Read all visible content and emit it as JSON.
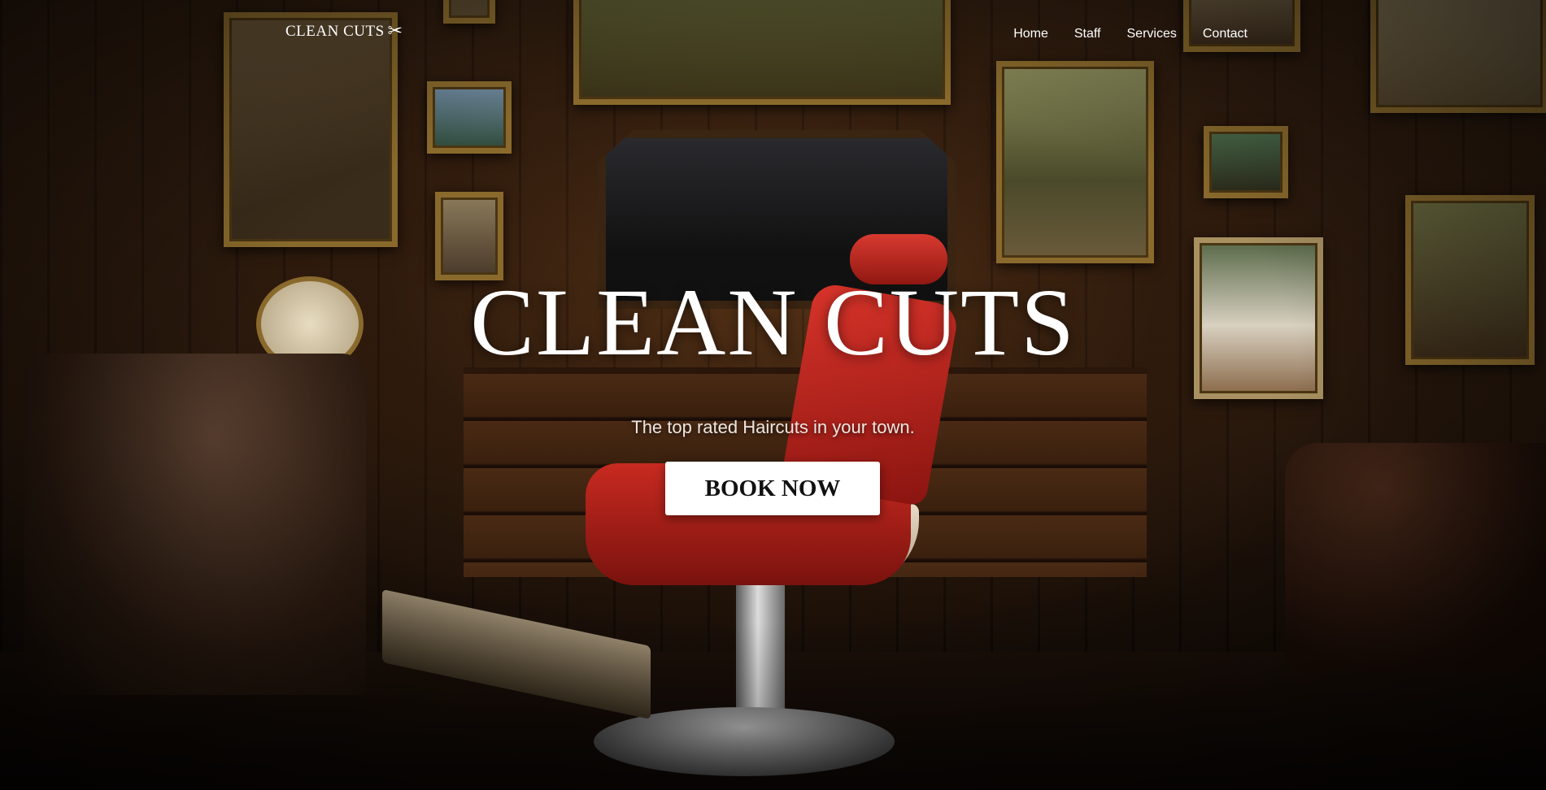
{
  "nav": {
    "logo_text": "CLEAN CUTS",
    "logo_icon": "scissors-icon",
    "links": [
      "Home",
      "Staff",
      "Services",
      "Contact"
    ]
  },
  "hero": {
    "title": "CLEAN CUTS",
    "subtitle": "The top rated Haircuts in your town.",
    "cta_label": "BOOK NOW"
  },
  "colors": {
    "text": "#ffffff",
    "button_bg": "#ffffff",
    "button_text": "#111111",
    "chair_red": "#c82a20"
  }
}
